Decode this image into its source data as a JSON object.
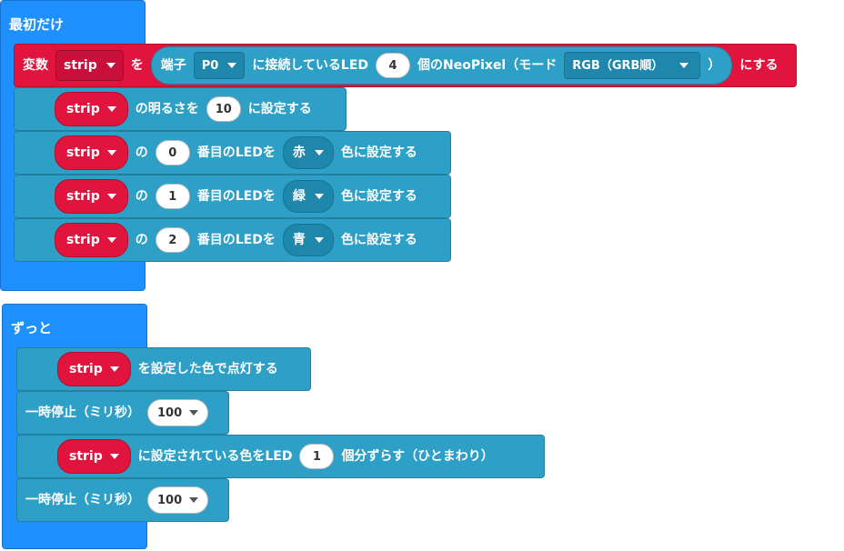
{
  "on_start": {
    "hat_label": "最初だけ",
    "set_var": {
      "prefix": "変数",
      "var_name": "strip",
      "wo": "を",
      "pin_label": "端子",
      "pin_value": "P0",
      "connected_label": "に接続しているLED",
      "led_count": "4",
      "count_suffix": "個のNeoPixel（モード",
      "mode_value": "RGB（GRB順）",
      "close_paren": "）",
      "suffix": "にする"
    },
    "brightness": {
      "var": "strip",
      "label": "の明るさを",
      "value": "10",
      "suffix": "に設定する"
    },
    "pixels": [
      {
        "var": "strip",
        "no": "の",
        "index": "0",
        "label": "番目のLEDを",
        "color": "赤",
        "suffix": "色に設定する"
      },
      {
        "var": "strip",
        "no": "の",
        "index": "1",
        "label": "番目のLEDを",
        "color": "緑",
        "suffix": "色に設定する"
      },
      {
        "var": "strip",
        "no": "の",
        "index": "2",
        "label": "番目のLEDを",
        "color": "青",
        "suffix": "色に設定する"
      }
    ]
  },
  "forever": {
    "hat_label": "ずっと",
    "show": {
      "var": "strip",
      "label": "を設定した色で点灯する"
    },
    "pause1": {
      "label": "一時停止（ミリ秒）",
      "value": "100"
    },
    "rotate": {
      "var": "strip",
      "label": "に設定されている色をLED",
      "count": "1",
      "suffix": "個分ずらす（ひとまわり）"
    },
    "pause2": {
      "label": "一時停止（ミリ秒）",
      "value": "100"
    }
  },
  "colors": {
    "event": "#1e90ff",
    "neopixel": "#2e9fc6",
    "variables": "#e0143c",
    "dropdown_dark": "#1f86ac"
  }
}
